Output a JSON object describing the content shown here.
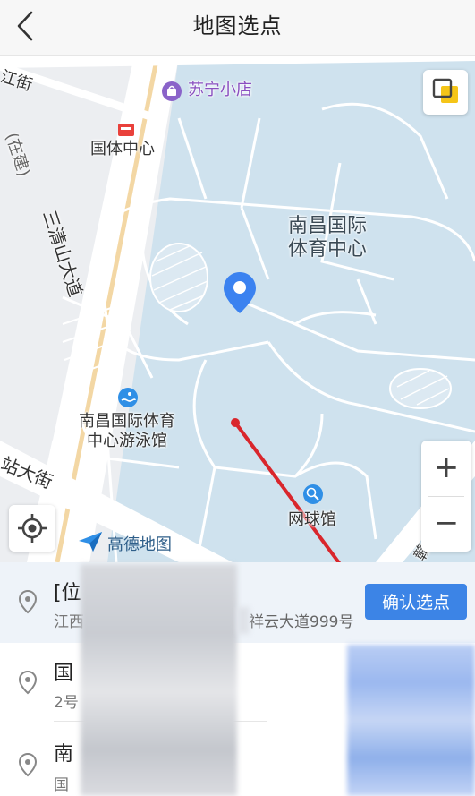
{
  "header": {
    "title": "地图选点",
    "back_icon": "chevron-left-icon"
  },
  "map": {
    "labels": {
      "suning": "苏宁小店",
      "guoti": "国体中心",
      "sports_center_l1": "南昌国际",
      "sports_center_l2": "体育中心",
      "pool_l1": "南昌国际体育",
      "pool_l2": "中心游泳馆",
      "tennis": "网球馆",
      "road_sanqing": "三清山大道",
      "road_jiang": "江街",
      "road_zai": "(在建)",
      "road_zhan": "站大街",
      "road_gan": "赣"
    },
    "logo_text": "高德地图",
    "zoom_in_label": "+",
    "zoom_out_label": "−",
    "colors": {
      "land": "#cfe2ee",
      "road": "#ffffff",
      "pin": "#3b82f0",
      "arrow": "#d9262c"
    }
  },
  "results": [
    {
      "title": "[位",
      "subtitle_prefix": "江西",
      "subtitle_suffix": "祥云大道999号",
      "selected": true
    },
    {
      "title": "国",
      "subtitle": "2号"
    },
    {
      "title": "南",
      "subtitle": "国"
    }
  ],
  "confirm_label": "确认选点"
}
